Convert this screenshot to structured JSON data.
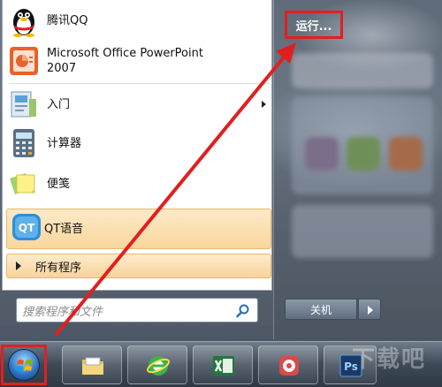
{
  "start_menu": {
    "pinned": [
      {
        "label": "腾讯QQ",
        "icon": "qq-penguin-icon"
      },
      {
        "label": "Microsoft Office PowerPoint 2007",
        "icon": "powerpoint-icon"
      }
    ],
    "recent": [
      {
        "label": "入门",
        "icon": "getting-started-icon",
        "has_submenu": true
      },
      {
        "label": "计算器",
        "icon": "calculator-icon"
      },
      {
        "label": "便笺",
        "icon": "sticky-notes-icon"
      },
      {
        "label": "QT语音",
        "icon": "qt-voice-icon",
        "highlighted": true
      }
    ],
    "all_programs_label": "所有程序",
    "search": {
      "placeholder": "搜索程序和文件"
    },
    "right_column": {
      "run_label": "运行..."
    },
    "shutdown_label": "关机"
  },
  "taskbar": {
    "apps": [
      {
        "name": "file-explorer-icon"
      },
      {
        "name": "ie-browser-icon"
      },
      {
        "name": "excel-icon"
      },
      {
        "name": "media-app-icon"
      },
      {
        "name": "photoshop-icon",
        "text": "Ps"
      }
    ]
  },
  "watermark": "下载吧",
  "colors": {
    "annotation_red": "#e02020",
    "highlight": "#f9d79d"
  }
}
